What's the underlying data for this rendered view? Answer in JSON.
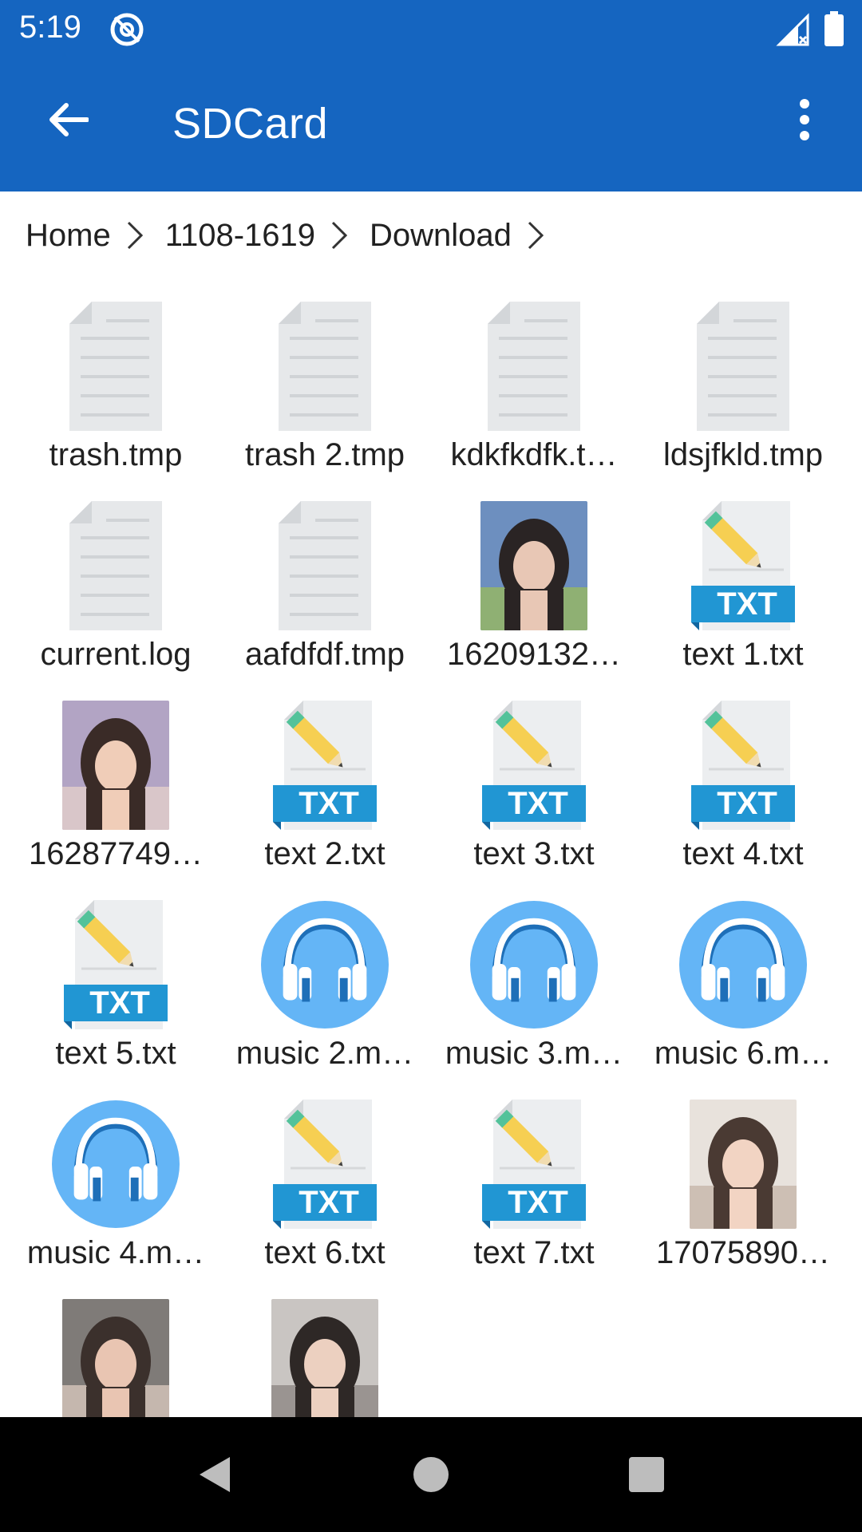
{
  "status": {
    "time": "5:19"
  },
  "appbar": {
    "title": "SDCard"
  },
  "breadcrumb": [
    "Home",
    "1108-1619",
    "Download"
  ],
  "files": [
    {
      "name": "trash.tmp",
      "type": "generic"
    },
    {
      "name": "trash 2.tmp",
      "type": "generic"
    },
    {
      "name": "kdkfkdfk.t…",
      "type": "generic"
    },
    {
      "name": "ldsjfkld.tmp",
      "type": "generic"
    },
    {
      "name": "current.log",
      "type": "generic"
    },
    {
      "name": "aafdfdf.tmp",
      "type": "generic"
    },
    {
      "name": "16209132…",
      "type": "image"
    },
    {
      "name": "text 1.txt",
      "type": "txt"
    },
    {
      "name": "16287749…",
      "type": "image"
    },
    {
      "name": "text 2.txt",
      "type": "txt"
    },
    {
      "name": "text 3.txt",
      "type": "txt"
    },
    {
      "name": "text 4.txt",
      "type": "txt"
    },
    {
      "name": "text 5.txt",
      "type": "txt"
    },
    {
      "name": "music 2.m…",
      "type": "music"
    },
    {
      "name": "music 3.m…",
      "type": "music"
    },
    {
      "name": "music 6.m…",
      "type": "music"
    },
    {
      "name": "music 4.m…",
      "type": "music"
    },
    {
      "name": "text 6.txt",
      "type": "txt"
    },
    {
      "name": "text 7.txt",
      "type": "txt"
    },
    {
      "name": "17075890…",
      "type": "image"
    },
    {
      "name": "",
      "type": "image"
    },
    {
      "name": "",
      "type": "image"
    }
  ],
  "colors": {
    "appbar": "#1565c0",
    "txt_banner": "#2196d3",
    "music_bg": "#64b5f6",
    "doc_gray": "#e6e8ea"
  }
}
